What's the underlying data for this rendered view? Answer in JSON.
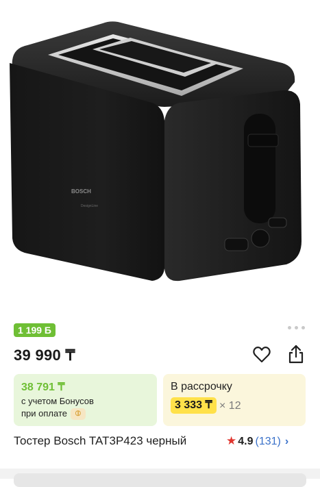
{
  "product": {
    "image_alt": "Toaster",
    "brand_label": "BOSCH",
    "line_label": "DesignLine"
  },
  "bonus_chip": {
    "text": "1 199 Б"
  },
  "gallery": {
    "dots": 3
  },
  "price": {
    "main": "39 990 ₸"
  },
  "bonus_box": {
    "amount": "38 791 ₸",
    "line1": "с учетом Бонусов",
    "line2": "при оплате",
    "coin_icon": "bonus-coin-icon"
  },
  "installment_box": {
    "title": "В рассрочку",
    "monthly": "3 333 ₸",
    "multiplier": "× 12"
  },
  "title": "Тостер Bosch TAT3P423 черный",
  "rating": {
    "value": "4.9",
    "count": "(131)"
  },
  "icons": {
    "favorite": "heart-icon",
    "share": "share-icon",
    "rating_star": "star-icon",
    "chevron": "chevron-right-icon"
  },
  "colors": {
    "bonus_green": "#6fbf35",
    "bonus_bg": "#e8f6db",
    "installment_bg": "#fbf6dc",
    "installment_pill": "#ffe14a",
    "rating_star": "#e0362f",
    "link_blue": "#3a71c9"
  }
}
